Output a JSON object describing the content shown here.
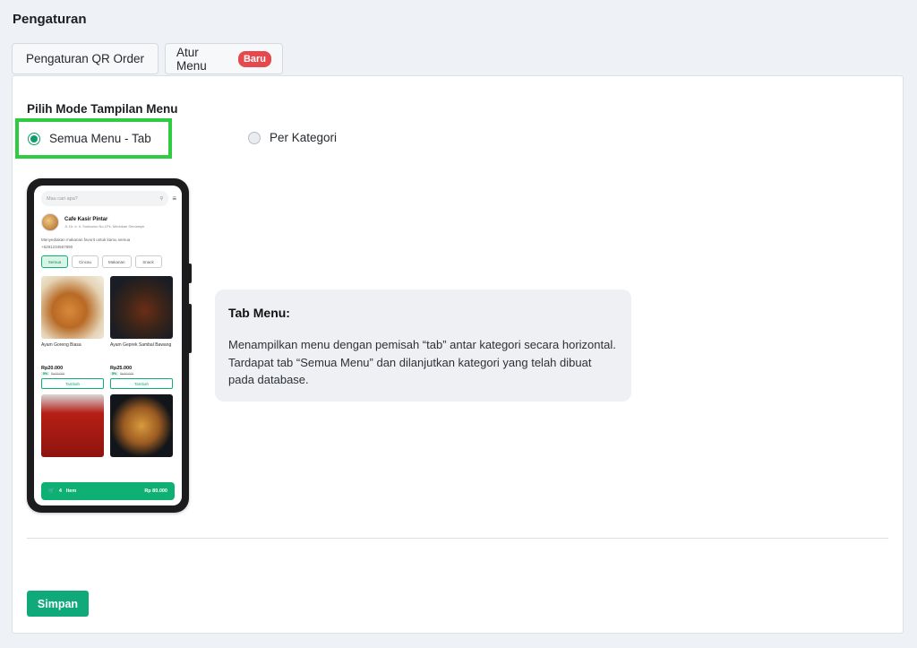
{
  "page": {
    "title": "Pengaturan"
  },
  "tabs": [
    {
      "label": "Pengaturan QR Order"
    },
    {
      "label": "Atur Menu",
      "badge": "Baru"
    }
  ],
  "mode": {
    "title": "Pilih Mode Tampilan Menu",
    "options": [
      {
        "label": "Semua Menu - Tab",
        "selected": true
      },
      {
        "label": "Per Kategori",
        "selected": false
      }
    ]
  },
  "preview": {
    "search_placeholder": "Mau cari apa?",
    "store_name": "Cafe Kasir Pintar",
    "store_address": "Jl. Dr. Ir. Ir. Soekarno No.1Pk. Medokan Semampir",
    "description": "Menyediakan makanan favorit untuk kamu semua",
    "phone": "+6281234567890",
    "categories": [
      "Semua",
      "Cincau",
      "Makanan",
      "Snack"
    ],
    "items": [
      {
        "name": "Ayam Goreng Biasa",
        "price": "Rp20.000",
        "discount_badge": "5%",
        "old_price": "Rp25.000",
        "button": "Tambah"
      },
      {
        "name": "Ayam Geprek Sambal Bawang",
        "price": "Rp25.000",
        "discount_badge": "5%",
        "old_price": "Rp30.000",
        "button": "Tambah"
      }
    ],
    "cart": {
      "count": "4",
      "unit": "Item",
      "total": "Rp 80.000"
    }
  },
  "info": {
    "title": "Tab Menu:",
    "body": "Menampilkan menu dengan pemisah “tab” antar kategori secara horizontal. Tardapat tab “Semua Menu” dan dilanjutkan kategori yang telah dibuat pada database."
  },
  "actions": {
    "save_label": "Simpan"
  },
  "colors": {
    "primary": "#0fa97a",
    "badge": "#e5484d",
    "highlight": "#2ecc40"
  }
}
